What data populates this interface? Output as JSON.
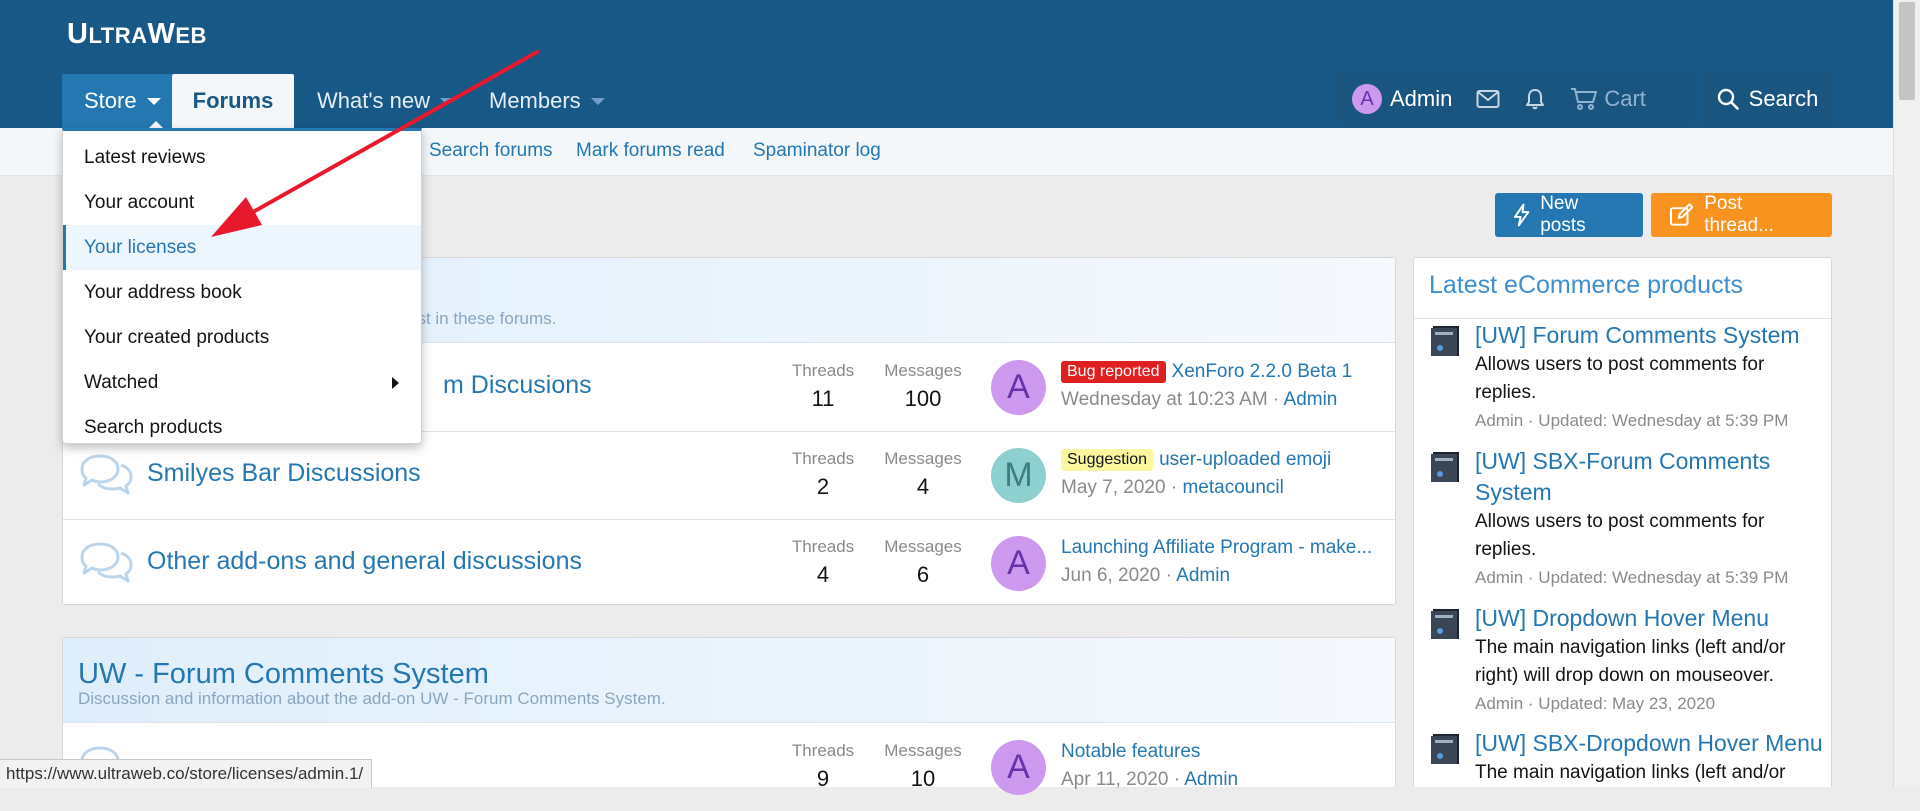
{
  "header": {
    "logo_main": "U",
    "logo_sc1": "LTRA",
    "logo_w": "W",
    "logo_sc2": "EB",
    "nav": {
      "store": "Store",
      "forums": "Forums",
      "whats_new": "What's new",
      "members": "Members"
    },
    "user": {
      "avatar_letter": "A",
      "name": "Admin",
      "cart": "Cart",
      "search": "Search"
    }
  },
  "subnav": {
    "links": [
      "Search forums",
      "Mark forums read",
      "Spaminator log"
    ]
  },
  "buttons": {
    "new_posts": "New posts",
    "post_thread": "Post thread..."
  },
  "store_menu": {
    "items": [
      "Latest reviews",
      "Your account",
      "Your licenses",
      "Your address book",
      "Your created products",
      "Watched",
      "Search products"
    ],
    "active_index": 2
  },
  "category1": {
    "description_fragment": "ost in these forums.",
    "nodes": [
      {
        "title": "m Discusions",
        "threads_label": "Threads",
        "threads": "11",
        "messages_label": "Messages",
        "messages": "100",
        "avatar": "A",
        "prefix": "Bug reported",
        "latest_title": "XenForo 2.2.0 Beta 1",
        "latest_date": "Wednesday at 10:23 AM",
        "latest_user": "Admin"
      },
      {
        "title": "Smilyes Bar Discussions",
        "threads_label": "Threads",
        "threads": "2",
        "messages_label": "Messages",
        "messages": "4",
        "avatar": "M",
        "prefix": "Suggestion",
        "latest_title": "user-uploaded emoji",
        "latest_date": "May 7, 2020",
        "latest_user": "metacouncil"
      },
      {
        "title": "Other add-ons and general discussions",
        "threads_label": "Threads",
        "threads": "4",
        "messages_label": "Messages",
        "messages": "6",
        "avatar": "A",
        "latest_title": "Launching Affiliate Program - make...",
        "latest_date": "Jun 6, 2020",
        "latest_user": "Admin"
      }
    ]
  },
  "category2": {
    "title": "UW - Forum Comments System",
    "description": "Discussion and information about the add-on UW - Forum Comments System.",
    "node": {
      "threads_label": "Threads",
      "threads": "9",
      "messages_label": "Messages",
      "messages": "10",
      "avatar": "A",
      "latest_title": "Notable features",
      "latest_date": "Apr 11, 2020",
      "latest_user": "Admin"
    }
  },
  "sidebar": {
    "title": "Latest eCommerce products",
    "products": [
      {
        "title": "[UW] Forum Comments System",
        "description": "Allows users to post comments for replies.",
        "meta": "Admin · Updated: Wednesday at 5:39 PM"
      },
      {
        "title": "[UW] SBX-Forum Comments System",
        "description": "Allows users to post comments for replies.",
        "meta": "Admin · Updated: Wednesday at 5:39 PM"
      },
      {
        "title": "[UW] Dropdown Hover Menu",
        "description": "The main navigation links (left and/or right) will drop down on mouseover.",
        "meta": "Admin · Updated: May 23, 2020"
      },
      {
        "title": "[UW] SBX-Dropdown Hover Menu",
        "description": "The main navigation links (left and/or",
        "meta": ""
      }
    ]
  },
  "statusbar": {
    "url": "https://www.ultraweb.co/store/licenses/admin.1/"
  },
  "colors": {
    "header_bg": "#185886",
    "accent": "#2577b1",
    "post_thread": "#f7931e",
    "annotation_arrow": "#e8192c"
  },
  "separator": "·"
}
